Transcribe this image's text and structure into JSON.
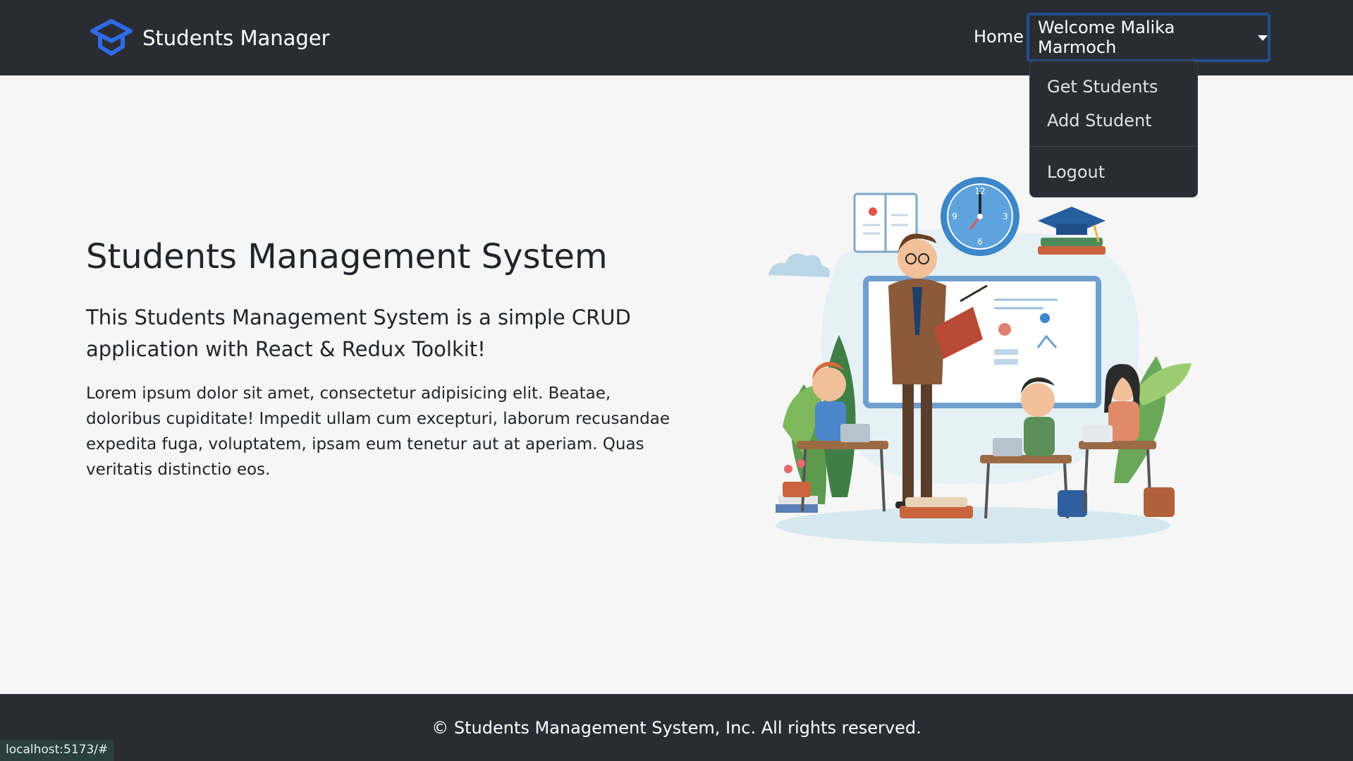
{
  "navbar": {
    "brand_icon": "graduation-cap-icon",
    "brand_text": "Students Manager",
    "home_link": "Home",
    "welcome_label": "Welcome Malika Marmoch",
    "accent_color": "#2f6be8",
    "bg_color": "#292d33"
  },
  "dropdown": {
    "items": [
      {
        "label": "Get Students"
      },
      {
        "label": "Add Student"
      },
      {
        "label": "Logout"
      }
    ]
  },
  "hero": {
    "title": "Students Management System",
    "lead": "This Students Management System is a simple CRUD application with React & Redux Toolkit!",
    "body": "Lorem ipsum dolor sit amet, consectetur adipisicing elit. Beatae, doloribus cupiditate! Impedit ullam cum excepturi, laborum recusandae expedita fuga, voluptatem, ipsam eum tenetur aut at aperiam. Quas veritatis distinctio eos.",
    "clock_numbers": [
      "12",
      "3",
      "6",
      "9"
    ]
  },
  "footer": {
    "text": "© Students Management System, Inc. All rights reserved."
  },
  "status_bar": {
    "url": "localhost:5173/#"
  }
}
